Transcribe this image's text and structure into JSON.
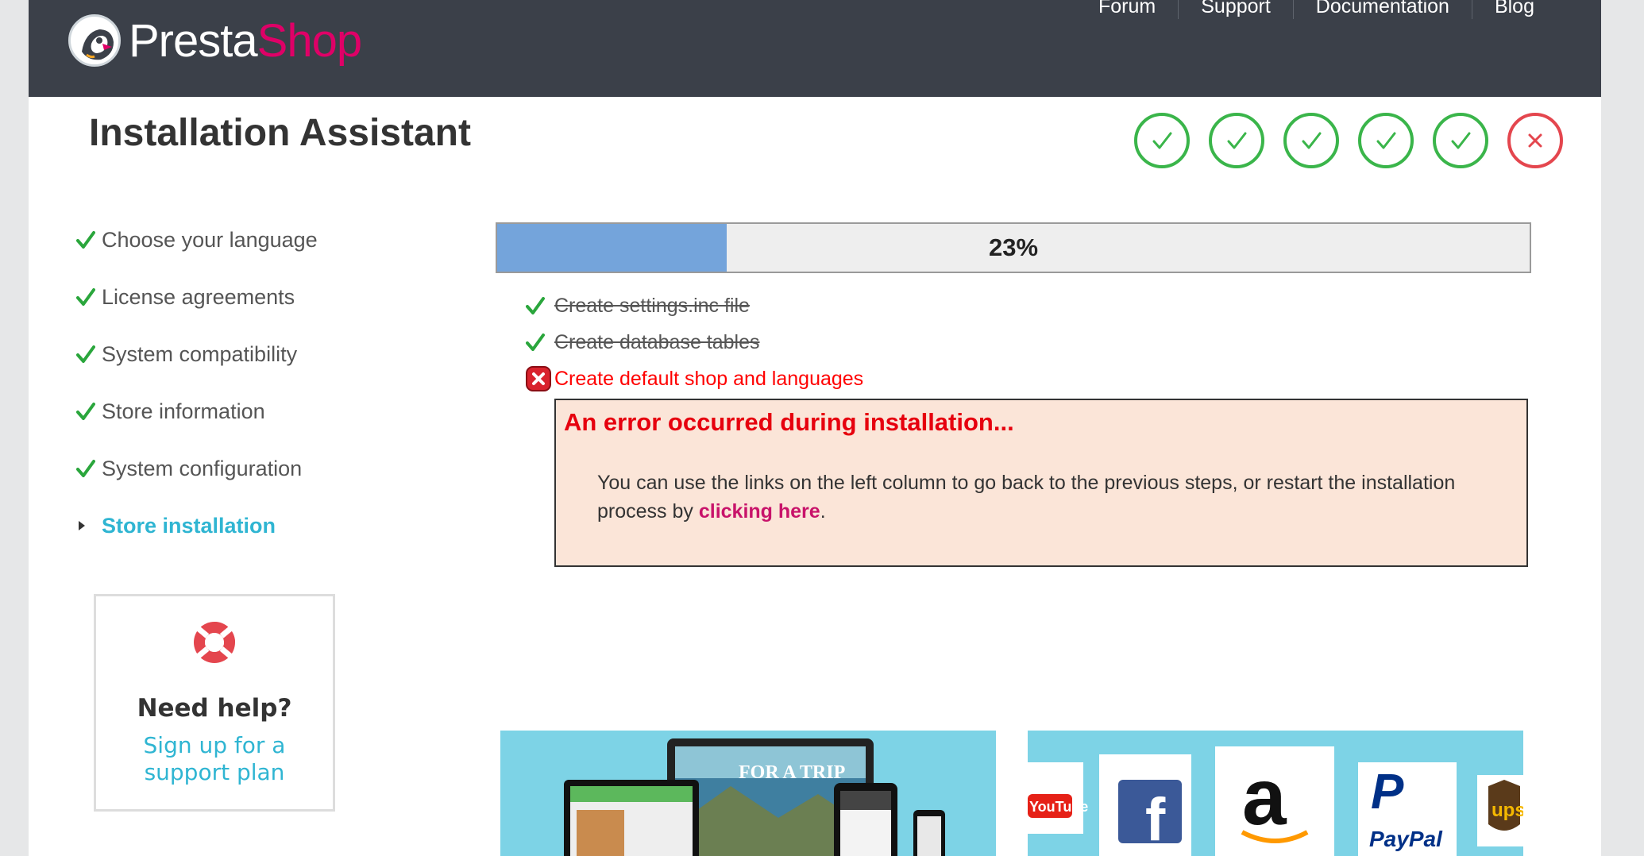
{
  "brand": {
    "name_part1": "Presta",
    "name_part2": "Shop"
  },
  "topnav": [
    {
      "label": "Forum"
    },
    {
      "label": "Support"
    },
    {
      "label": "Documentation"
    },
    {
      "label": "Blog"
    }
  ],
  "page": {
    "title": "Installation Assistant"
  },
  "step_indicators": {
    "completed": 5,
    "failed": 1,
    "completed_color": "#3ab54a",
    "failed_color": "#e4464e"
  },
  "sidebar": {
    "items": [
      {
        "label": "Choose your language",
        "state": "done"
      },
      {
        "label": "License agreements",
        "state": "done"
      },
      {
        "label": "System compatibility",
        "state": "done"
      },
      {
        "label": "Store information",
        "state": "done"
      },
      {
        "label": "System configuration",
        "state": "done"
      },
      {
        "label": "Store installation",
        "state": "active"
      }
    ]
  },
  "help": {
    "title": "Need help?",
    "link": "Sign up for a support plan"
  },
  "progress": {
    "label": "23%",
    "fraction": 0.222
  },
  "tasks": [
    {
      "label": "Create settings.inc file",
      "state": "done"
    },
    {
      "label": "Create database tables",
      "state": "done"
    },
    {
      "label": "Create default shop and languages",
      "state": "failed"
    }
  ],
  "error": {
    "title": "An error occurred during installation...",
    "message_before": "You can use the links on the left column to go back to the previous steps, or restart the installation process by ",
    "link": "clicking here",
    "message_after": "."
  },
  "banners": {
    "left_text": "FOR A TRIP",
    "logos": [
      "YouTube",
      "f",
      "a",
      "PayPal",
      "ups"
    ]
  },
  "colors": {
    "header_bg": "#3b4049",
    "accent": "#2fb5d2",
    "brand_pink": "#df0067",
    "success": "#3ab54a",
    "error": "#ff0000",
    "error_box_bg": "#fbe5d8",
    "progress_fill": "#74a4db"
  }
}
